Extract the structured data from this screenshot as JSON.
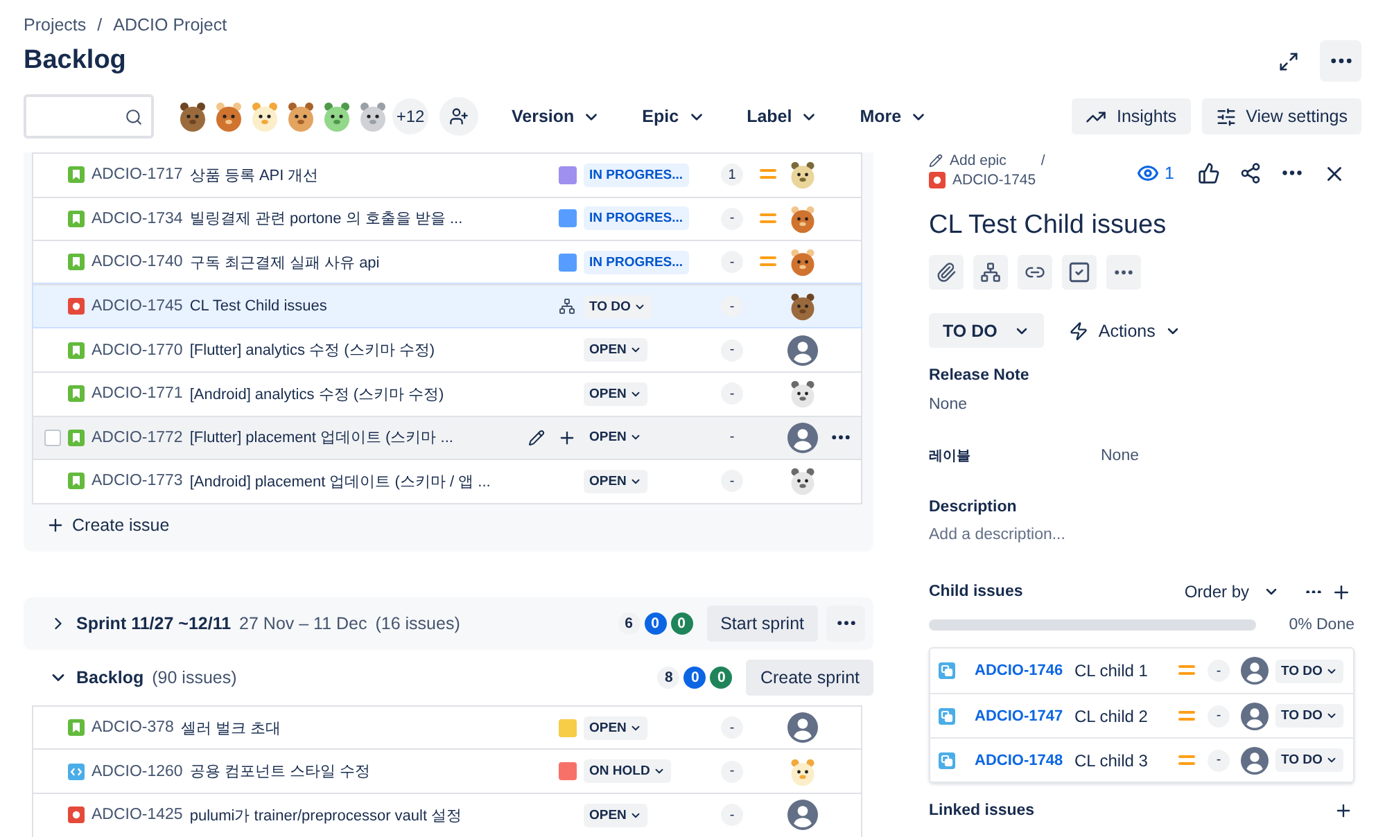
{
  "breadcrumbs": [
    "Projects",
    "ADCIO Project"
  ],
  "breadcrumb_separator": "/",
  "title": "Backlog",
  "avatars": [
    {
      "kind": "bear"
    },
    {
      "kind": "owl"
    },
    {
      "kind": "duck"
    },
    {
      "kind": "lion"
    },
    {
      "kind": "chameleon"
    },
    {
      "kind": "seal"
    }
  ],
  "avatar_overflow": "+12",
  "filters": [
    "Version",
    "Epic",
    "Label",
    "More"
  ],
  "actions": [
    {
      "label": "Insights",
      "kind": "chart"
    },
    {
      "label": "View settings",
      "kind": "sliders"
    }
  ],
  "sprint_issues": {
    "rows": [
      {
        "kind": "story",
        "key": "ADCIO-1717",
        "summary": "상품 등록 API 개선",
        "epic": {
          "color": "#9f8fef"
        },
        "status": {
          "label": "IN PROGRES...",
          "kind": "progress"
        },
        "estimate": "1",
        "priority": {
          "kind": "medium"
        },
        "avatar": {
          "kind": "zebra"
        },
        "selected": false,
        "hovered": false,
        "has_children": false
      },
      {
        "kind": "story",
        "key": "ADCIO-1734",
        "summary": "빌링결제 관련 portone 의 호출을 받을 ...",
        "epic": {
          "color": "#579dff"
        },
        "status": {
          "label": "IN PROGRES...",
          "kind": "progress"
        },
        "estimate": "-",
        "priority": {
          "kind": "medium"
        },
        "avatar": {
          "kind": "owl"
        },
        "selected": false,
        "hovered": false,
        "has_children": false
      },
      {
        "kind": "story",
        "key": "ADCIO-1740",
        "summary": "구독 최근결제 실패 사유 api",
        "epic": {
          "color": "#579dff"
        },
        "status": {
          "label": "IN PROGRES...",
          "kind": "progress"
        },
        "estimate": "-",
        "priority": {
          "kind": "medium"
        },
        "avatar": {
          "kind": "owl"
        },
        "selected": false,
        "hovered": false,
        "has_children": false
      },
      {
        "kind": "bug",
        "key": "ADCIO-1745",
        "summary": "CL Test Child issues",
        "status": {
          "label": "TO DO",
          "kind": "todo"
        },
        "estimate": "-",
        "avatar": {
          "kind": "bear"
        },
        "selected": true,
        "hovered": false,
        "has_children": true
      },
      {
        "kind": "story",
        "key": "ADCIO-1770",
        "summary": "[Flutter] analytics 수정 (스키마 수정)",
        "status": {
          "label": "OPEN",
          "kind": "todo"
        },
        "estimate": "-",
        "avatar": {
          "kind": "user"
        },
        "selected": false,
        "hovered": false,
        "has_children": false
      },
      {
        "kind": "story",
        "key": "ADCIO-1771",
        "summary": "[Android] analytics 수정 (스키마 수정)",
        "status": {
          "label": "OPEN",
          "kind": "todo"
        },
        "estimate": "-",
        "avatar": {
          "kind": "panda"
        },
        "selected": false,
        "hovered": false,
        "has_children": false
      },
      {
        "kind": "story",
        "key": "ADCIO-1772",
        "summary": "[Flutter] placement 업데이트 (스키마 ...",
        "status": {
          "label": "OPEN",
          "kind": "todo"
        },
        "estimate": "-",
        "avatar": {
          "kind": "user"
        },
        "selected": false,
        "hovered": true,
        "checked": false,
        "has_children": false
      },
      {
        "kind": "story",
        "key": "ADCIO-1773",
        "summary": "[Android] placement 업데이트 (스키마 / 앱 ...",
        "status": {
          "label": "OPEN",
          "kind": "todo"
        },
        "estimate": "-",
        "avatar": {
          "kind": "panda"
        },
        "selected": false,
        "hovered": false,
        "has_children": false
      }
    ],
    "create_issue": "Create issue"
  },
  "sprint": {
    "name": "Sprint 11/27 ~12/11",
    "dates": "27 Nov – 11 Dec",
    "count": "(16 issues)",
    "expanded": false,
    "counts": [
      {
        "value": "6",
        "kind": "todo"
      },
      {
        "value": "0",
        "kind": "progress"
      },
      {
        "value": "0",
        "kind": "done"
      }
    ],
    "button": "Start sprint"
  },
  "backlog": {
    "name": "Backlog",
    "count": "(90 issues)",
    "expanded": true,
    "counts": [
      {
        "value": "8",
        "kind": "todo"
      },
      {
        "value": "0",
        "kind": "progress"
      },
      {
        "value": "0",
        "kind": "done"
      }
    ],
    "button": "Create sprint",
    "rows": [
      {
        "kind": "story",
        "key": "ADCIO-378",
        "summary": "셀러 벌크 초대",
        "epic": {
          "color": "#f5cd47"
        },
        "status": {
          "label": "OPEN",
          "kind": "todo"
        },
        "estimate": "-",
        "avatar": {
          "kind": "user"
        },
        "selected": false,
        "hovered": false,
        "has_children": false
      },
      {
        "kind": "dev",
        "key": "ADCIO-1260",
        "summary": "공용 컴포넌트 스타일 수정",
        "epic": {
          "color": "#f87168"
        },
        "status": {
          "label": "ON HOLD",
          "kind": "todo"
        },
        "estimate": "-",
        "avatar": {
          "kind": "duck"
        },
        "selected": false,
        "hovered": false,
        "has_children": false
      },
      {
        "kind": "bug",
        "key": "ADCIO-1425",
        "summary": "pulumi가 trainer/preprocessor vault 설정",
        "status": {
          "label": "OPEN",
          "kind": "todo"
        },
        "estimate": "-",
        "avatar": {
          "kind": "user"
        },
        "selected": false,
        "hovered": false,
        "has_children": false
      }
    ]
  },
  "detail": {
    "add_epic": "Add epic",
    "separator": "/",
    "issue_type": {
      "kind": "bug"
    },
    "issue_key": "ADCIO-1745",
    "watchers": "1",
    "title": "CL Test Child issues",
    "status": "TO DO",
    "actions": "Actions",
    "fields": [
      {
        "label": "Release Note",
        "value": "None",
        "kind": "stacked"
      },
      {
        "label": "레이블",
        "value": "None",
        "kind": "inline"
      }
    ],
    "description": {
      "label": "Description",
      "prompt": "Add a description..."
    },
    "child_issues": {
      "label": "Child issues",
      "order_by": "Order by",
      "level": 0,
      "progress_text": "0% Done",
      "rows": [
        {
          "key": "ADCIO-1746",
          "summary": "CL child 1",
          "priority": {
            "kind": "medium"
          },
          "estimate": "-",
          "status": "TO DO"
        },
        {
          "key": "ADCIO-1747",
          "summary": "CL child 2",
          "priority": {
            "kind": "medium"
          },
          "estimate": "-",
          "status": "TO DO"
        },
        {
          "key": "ADCIO-1748",
          "summary": "CL child 3",
          "priority": {
            "kind": "medium"
          },
          "estimate": "-",
          "status": "TO DO"
        }
      ]
    },
    "linked_issues": "Linked issues"
  }
}
